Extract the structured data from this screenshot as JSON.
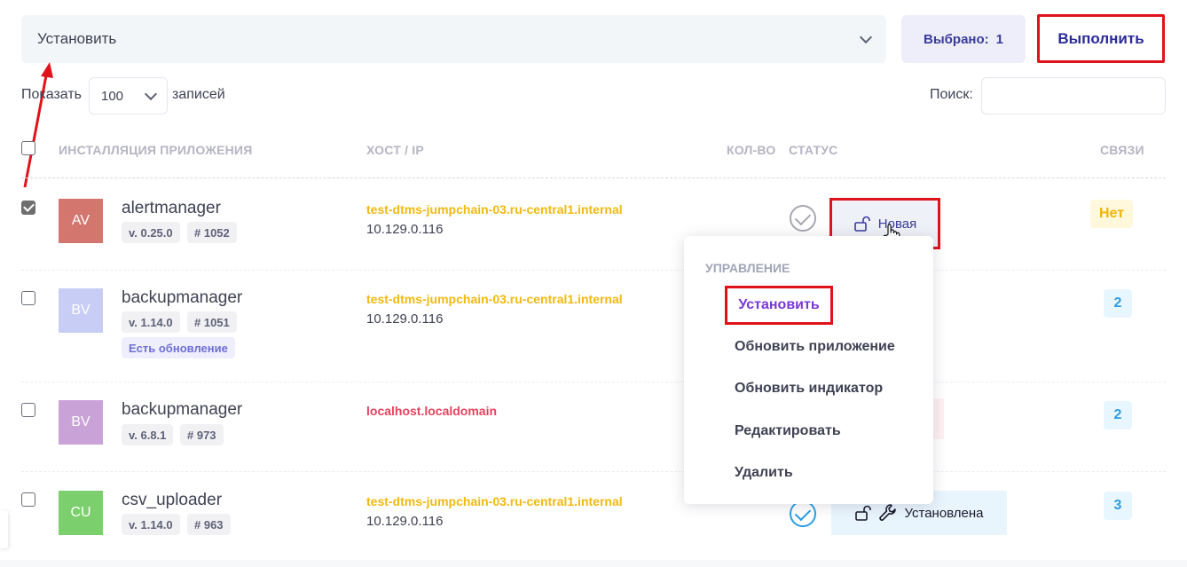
{
  "toolbar": {
    "action_select": "Установить",
    "selected_label": "Выбрано:",
    "selected_count": "1",
    "run_label": "Выполнить"
  },
  "controls": {
    "show_label": "Показать",
    "page_size": "100",
    "records_label": "записей",
    "search_label": "Поиск:",
    "search_value": ""
  },
  "table": {
    "headers": {
      "install": "ИНСТАЛЛЯЦИЯ ПРИЛОЖЕНИЯ",
      "host": "ХОСТ / IP",
      "count": "КОЛ-ВО",
      "status": "СТАТУС",
      "links": "СВЯЗИ"
    },
    "rows": [
      {
        "checked": true,
        "avatar": "AV",
        "avatar_color": "#d2766e",
        "name": "alertmanager",
        "version": "v. 0.25.0",
        "number": "# 1052",
        "host": "test-dtms-jumpchain-03.ru-central1.internal",
        "ip": "10.129.0.116",
        "status": "Новая",
        "links": "Нет"
      },
      {
        "checked": false,
        "avatar": "BV",
        "avatar_color": "#c7cdf4",
        "name": "backupmanager",
        "version": "v. 1.14.0",
        "number": "# 1051",
        "update_tag": "Есть обновление",
        "host": "test-dtms-jumpchain-03.ru-central1.internal",
        "ip": "10.129.0.116",
        "links": "2"
      },
      {
        "checked": false,
        "avatar": "BV",
        "avatar_color": "#c9a2d8",
        "name": "backupmanager",
        "version": "v. 6.8.1",
        "number": "# 973",
        "host": "localhost.localdomain",
        "links": "2"
      },
      {
        "checked": false,
        "avatar": "CU",
        "avatar_color": "#7ccf6d",
        "name": "csv_uploader",
        "version": "v. 1.14.0",
        "number": "# 963",
        "host": "test-dtms-jumpchain-03.ru-central1.internal",
        "ip": "10.129.0.116",
        "status": "Установлена",
        "links": "3"
      }
    ]
  },
  "menu": {
    "heading": "УПРАВЛЕНИЕ",
    "items": [
      "Установить",
      "Обновить приложение",
      "Обновить индикатор",
      "Редактировать",
      "Удалить"
    ]
  },
  "colors": {
    "accent_red": "#e0121a",
    "host_yellow": "#f2b90f",
    "host_red": "#e8425d",
    "brand_blue": "#3a3a9e"
  }
}
